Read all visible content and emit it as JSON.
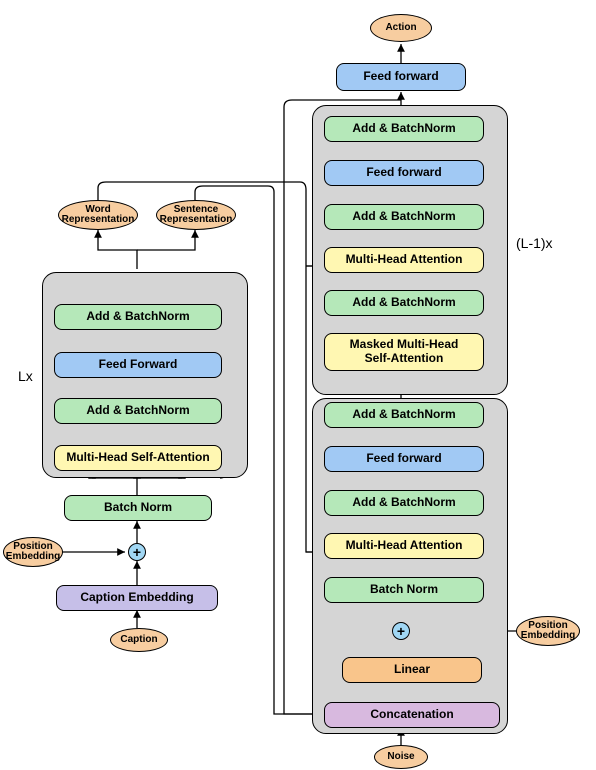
{
  "top": {
    "action": "Action",
    "feedforward_top": "Feed forward"
  },
  "decoder_top": {
    "addnorm3": "Add & BatchNorm",
    "feedforward": "Feed forward",
    "addnorm2": "Add & BatchNorm",
    "mha": "Multi-Head Attention",
    "addnorm1": "Add & BatchNorm",
    "masked_self_attn": "Masked Multi-Head\nSelf-Attention",
    "multiplier": "(L-1)x"
  },
  "decoder_bottom": {
    "addnorm2": "Add & BatchNorm",
    "feedforward": "Feed forward",
    "addnorm1": "Add & BatchNorm",
    "mha": "Multi-Head Attention",
    "batchnorm": "Batch Norm",
    "linear": "Linear",
    "concat": "Concatenation",
    "noise": "Noise",
    "pos_embed": "Position\nEmbedding"
  },
  "encoder": {
    "addnorm2": "Add & BatchNorm",
    "feedforward": "Feed Forward",
    "addnorm1": "Add & BatchNorm",
    "self_attn": "Multi-Head Self-Attention",
    "batchnorm": "Batch Norm",
    "caption_embed": "Caption Embedding",
    "caption": "Caption",
    "pos_embed": "Position\nEmbedding",
    "word_rep": "Word\nRepresentation",
    "sent_rep": "Sentence\nRepresentation",
    "multiplier": "Lx"
  }
}
